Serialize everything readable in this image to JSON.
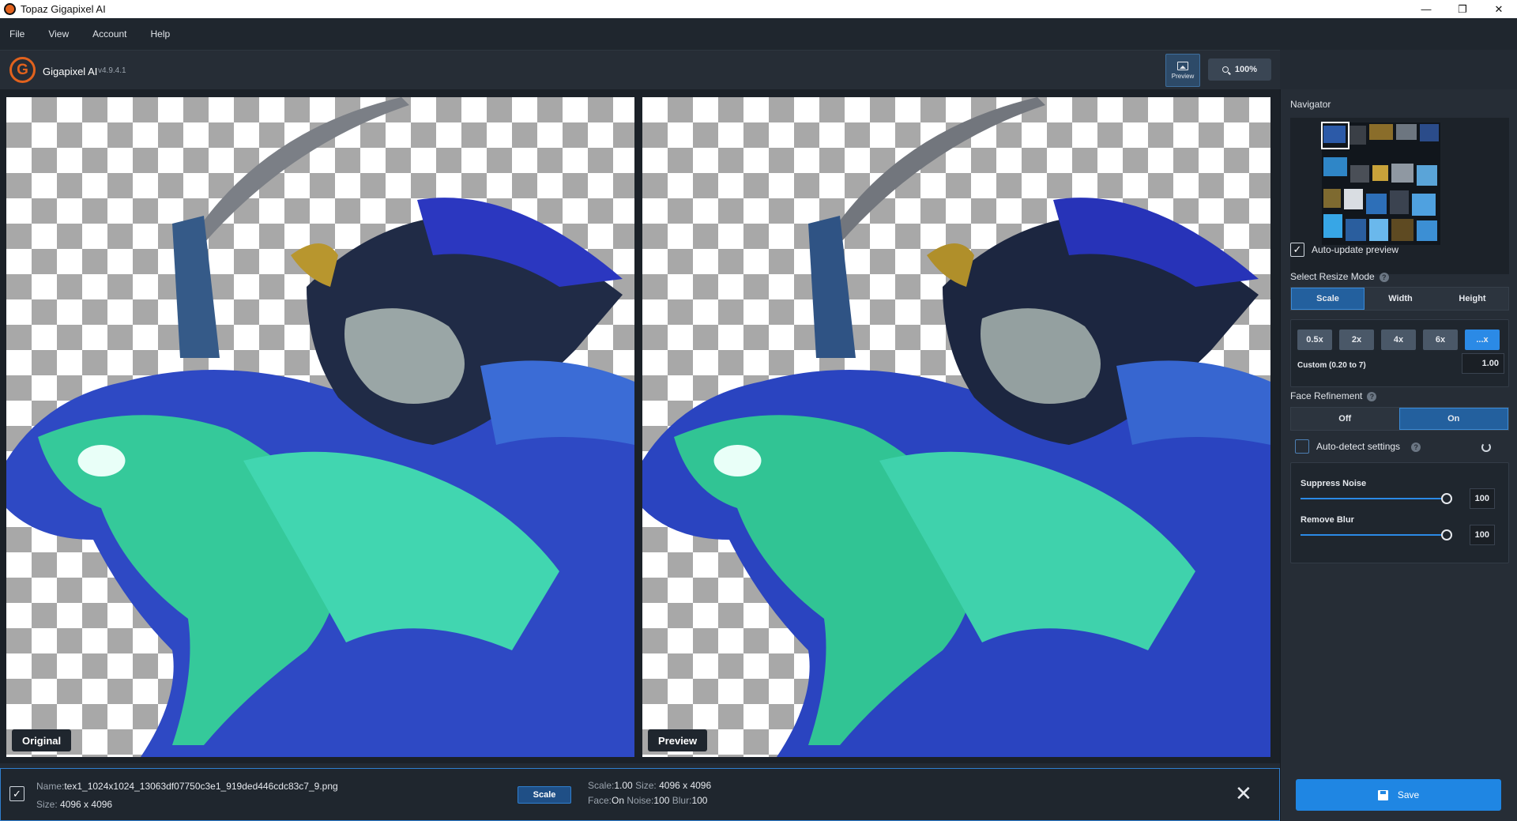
{
  "window": {
    "title": "Topaz Gigapixel AI",
    "controls": {
      "minimize": "—",
      "restore": "❐",
      "close": "✕"
    }
  },
  "menu": [
    "File",
    "View",
    "Account",
    "Help"
  ],
  "header": {
    "logo_letter": "G",
    "app_name": "Gigapixel AI",
    "version": "v4.9.4.1",
    "preview_button": "Preview",
    "zoom": "100%"
  },
  "canvas": {
    "left_label": "Original",
    "right_label": "Preview"
  },
  "statusbar": {
    "checked": true,
    "name_label": "Name:",
    "name_value": "tex1_1024x1024_13063df07750c3e1_919ded446cdc83c7_9.png",
    "size_label": "Size:",
    "size_value": "4096 x 4096",
    "mode_button": "Scale",
    "scale_label": "Scale:",
    "scale_value": "1.00",
    "out_size_label": "Size:",
    "out_size_value": "4096 x 4096",
    "face_label": "Face:",
    "face_value": "On",
    "noise_label": "Noise:",
    "noise_value": "100",
    "blur_label": "Blur:",
    "blur_value": "100",
    "close_icon": "✕"
  },
  "panel": {
    "navigator_title": "Navigator",
    "auto_update_label": "Auto-update preview",
    "auto_update_checked": true,
    "resize_mode_title": "Select Resize Mode",
    "help_glyph": "?",
    "resize_modes": [
      "Scale",
      "Width",
      "Height"
    ],
    "resize_mode_active": "Scale",
    "scale_options": [
      "0.5x",
      "2x",
      "4x",
      "6x",
      "...x"
    ],
    "scale_active": "...x",
    "custom_label": "Custom (0.20 to 7)",
    "custom_value": "1.00",
    "face_refinement_title": "Face Refinement",
    "face_options": [
      "Off",
      "On"
    ],
    "face_active": "On",
    "auto_detect_label": "Auto-detect settings",
    "auto_detect_checked": false,
    "suppress_noise_label": "Suppress Noise",
    "suppress_noise_value": "100",
    "remove_blur_label": "Remove Blur",
    "remove_blur_value": "100"
  },
  "save_button": "Save",
  "colors": {
    "accent": "#2b8ae6",
    "brand": "#e2621d",
    "panel_bg": "#262d36"
  }
}
